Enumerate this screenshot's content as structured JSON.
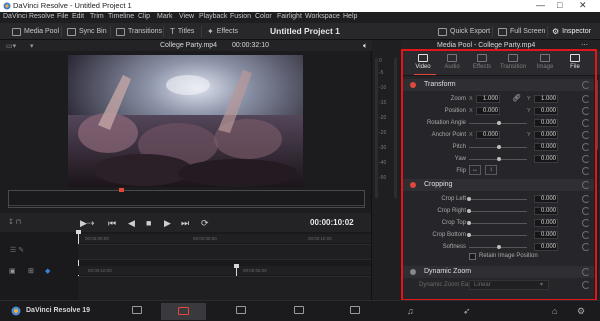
{
  "window": {
    "title": "DaVinci Resolve - Untitled Project 1",
    "controls": [
      "—",
      "□",
      "✕"
    ]
  },
  "menu": [
    "DaVinci Resolve",
    "File",
    "Edit",
    "Trim",
    "Timeline",
    "Clip",
    "Mark",
    "View",
    "Playback",
    "Fusion",
    "Color",
    "Fairlight",
    "Workspace",
    "Help"
  ],
  "toolbar": {
    "media_pool": "Media Pool",
    "sync_bin": "Sync Bin",
    "transitions": "Transitions",
    "titles": "Titles",
    "effects": "Effects",
    "project_title": "Untitled Project 1",
    "quick_export": "Quick Export",
    "full_screen": "Full Screen",
    "inspector": "Inspector"
  },
  "viewer": {
    "clip_name": "College Party.mp4",
    "timecode": "00:00:32:10",
    "playhead_timecode": "00:00:10:02"
  },
  "timeline": {
    "ruler_top": [
      "00:00:05:00",
      "00:00:08:00",
      "00:00:10:00"
    ],
    "ruler_bottom": [
      "00:00:10:00",
      "00:00:06:00"
    ]
  },
  "inspector": {
    "header_title": "Media Pool - College Party.mp4",
    "tabs": [
      "Video",
      "Audio",
      "Effects",
      "Transition",
      "Image",
      "File"
    ],
    "active_tab": "Video",
    "transform": {
      "title": "Transform",
      "zoom_label": "Zoom",
      "zoom_x_axis": "X",
      "zoom_x": "1.000",
      "zoom_y_axis": "Y",
      "zoom_y": "1.000",
      "position_label": "Position",
      "position_x_axis": "X",
      "position_x": "0.000",
      "position_y_axis": "Y",
      "position_y": "0.000",
      "rotation_label": "Rotation Angle",
      "rotation": "0.000",
      "anchor_label": "Anchor Point",
      "anchor_x_axis": "X",
      "anchor_x": "0.000",
      "anchor_y_axis": "Y",
      "anchor_y": "0.000",
      "pitch_label": "Pitch",
      "pitch": "0.000",
      "yaw_label": "Yaw",
      "yaw": "0.000",
      "flip_label": "Flip"
    },
    "cropping": {
      "title": "Cropping",
      "left_label": "Crop Left",
      "left": "0.000",
      "right_label": "Crop Right",
      "right": "0.000",
      "top_label": "Crop Top",
      "top": "0.000",
      "bottom_label": "Crop Bottom",
      "bottom": "0.000",
      "softness_label": "Softness",
      "softness": "0.000",
      "retain_label": "Retain Image Position"
    },
    "dynamic_zoom": {
      "title": "Dynamic Zoom",
      "ease_label": "Dynamic Zoom Ease",
      "ease_value": "Linear"
    }
  },
  "bottom": {
    "app_name": "DaVinci Resolve 19"
  },
  "colors": {
    "accent_red": "#e0483a",
    "highlight_red": "#e3151b",
    "panel": "#26262a"
  }
}
